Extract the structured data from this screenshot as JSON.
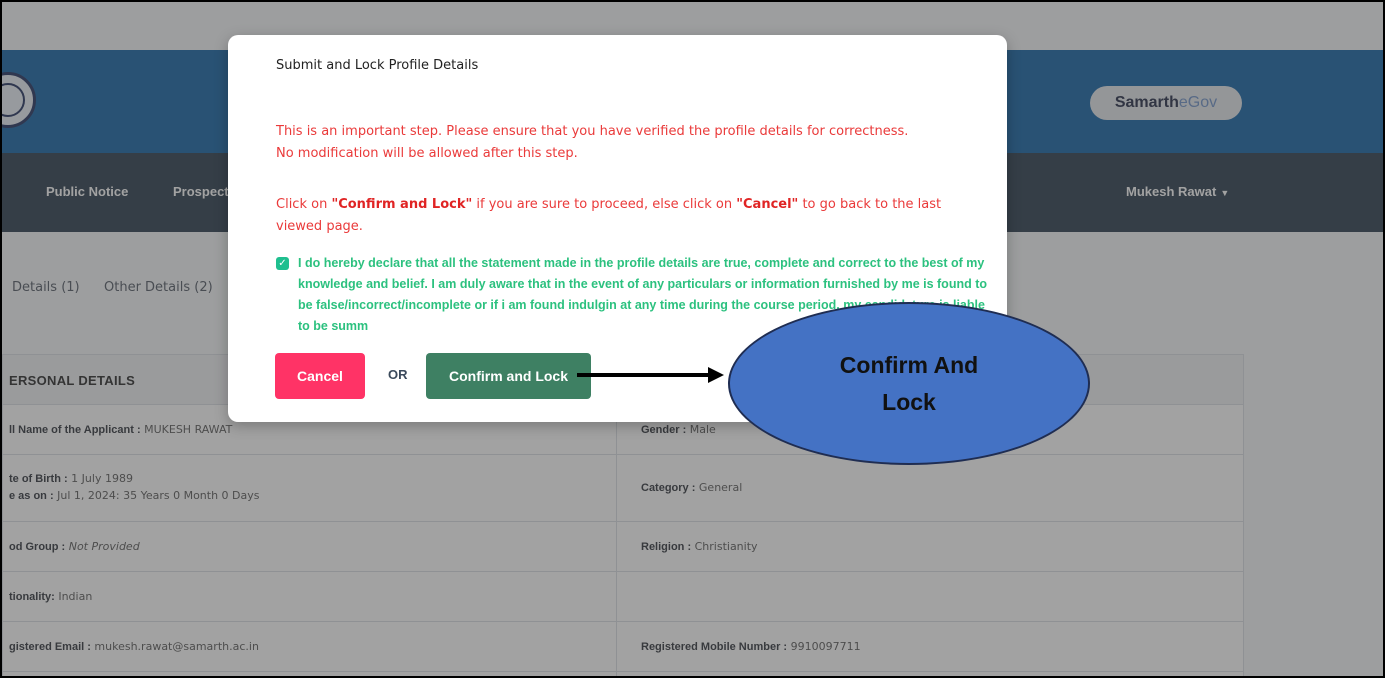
{
  "header": {
    "brand_bold": "Samarth",
    "brand_light": "eGov"
  },
  "nav": {
    "items": [
      "Public Notice",
      "Prospectus"
    ],
    "user": "Mukesh Rawat"
  },
  "tabs": [
    "Details (1)",
    "Other Details (2)"
  ],
  "personal_details": {
    "title": "ERSONAL DETAILS",
    "rows": [
      {
        "left_label": "ll Name of the Applicant :",
        "left_value": "MUKESH RAWAT",
        "right_label": "Gender :",
        "right_value": "Male"
      },
      {
        "left_label": "te of Birth :",
        "left_value": "1 July 1989",
        "left_label2": "e as on :",
        "left_value2": "Jul 1, 2024: 35 Years 0 Month 0 Days",
        "right_label": "Category :",
        "right_value": "General"
      },
      {
        "left_label": "od Group :",
        "left_value": "Not Provided",
        "right_label": "Religion :",
        "right_value": "Christianity"
      },
      {
        "left_label": "tionality:",
        "left_value": "Indian",
        "right_label": "",
        "right_value": ""
      },
      {
        "left_label": "gistered Email :",
        "left_value": "mukesh.rawat@samarth.ac.in",
        "right_label": "Registered Mobile Number :",
        "right_value": "9910097711"
      }
    ]
  },
  "modal": {
    "title": "Submit and Lock Profile Details",
    "warning_line1": "This is an important step. Please ensure that you have verified the profile details for correctness.",
    "warning_line2": "No modification will be allowed after this step.",
    "instr_pre": "Click on ",
    "instr_confirm": "\"Confirm and Lock\"",
    "instr_mid": " if you are sure to proceed, else click on ",
    "instr_cancel": "\"Cancel\"",
    "instr_post": " to go back to the last viewed page.",
    "declaration_checked": true,
    "declaration": "I do hereby declare that all the statement made in the profile details are true, complete and correct to the best of my knowledge and belief. I am duly aware that in the event of any particulars or information furnished by me is found to be false/incorrect/incomplete or if i am found indulgin at any time during the course period, my candidature is liable to be summ",
    "cancel_label": "Cancel",
    "or_label": "OR",
    "confirm_label": "Confirm and Lock"
  },
  "annotation": {
    "line1": "Confirm And",
    "line2": "Lock"
  },
  "colors": {
    "header_blue": "#0d5fa3",
    "navbar": "#243648",
    "warning_red": "#ea3a3a",
    "declaration_green": "#2cc17f",
    "cancel_pink": "#ff3366",
    "confirm_green": "#3e8063",
    "callout_blue": "#4472c4"
  }
}
